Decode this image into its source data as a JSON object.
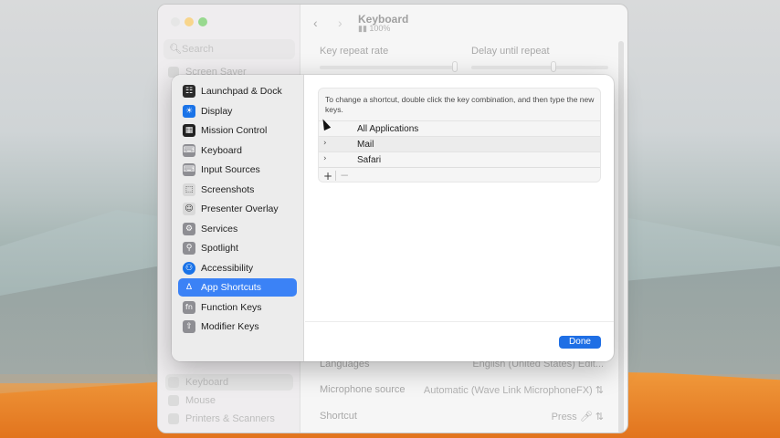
{
  "background_window": {
    "title": "Keyboard",
    "subtitle": "100%",
    "search_placeholder": "Search",
    "sidebar_items": [
      "Screen Saver",
      "Keyboard",
      "Mouse",
      "Printers & Scanners"
    ],
    "labels": {
      "key_repeat": "Key repeat rate",
      "delay_repeat": "Delay until repeat"
    },
    "rows": [
      {
        "label": "Languages",
        "value": "English (United States)",
        "action": "Edit..."
      },
      {
        "label": "Microphone source",
        "value": "Automatic (Wave Link MicrophoneFX)"
      },
      {
        "label": "Shortcut",
        "value": "Press"
      }
    ]
  },
  "modal": {
    "sidebar": [
      {
        "label": "Launchpad & Dock",
        "icon": "launchpad-icon",
        "color": "#2b2b2b"
      },
      {
        "label": "Display",
        "icon": "display-icon",
        "color": "#1a73e8"
      },
      {
        "label": "Mission Control",
        "icon": "mission-control-icon",
        "color": "#222222"
      },
      {
        "label": "Keyboard",
        "icon": "keyboard-icon",
        "color": "#8e8e93"
      },
      {
        "label": "Input Sources",
        "icon": "input-sources-icon",
        "color": "#8e8e93"
      },
      {
        "label": "Screenshots",
        "icon": "screenshots-icon",
        "color": "#d9d9d9"
      },
      {
        "label": "Presenter Overlay",
        "icon": "presenter-overlay-icon",
        "color": "#d9d9d9"
      },
      {
        "label": "Services",
        "icon": "services-gear-icon",
        "color": "#8e8e93"
      },
      {
        "label": "Spotlight",
        "icon": "spotlight-search-icon",
        "color": "#8e8e93"
      },
      {
        "label": "Accessibility",
        "icon": "accessibility-icon",
        "color": "#1a73e8"
      },
      {
        "label": "App Shortcuts",
        "icon": "app-shortcuts-icon",
        "color": "#3b82f6",
        "selected": true
      },
      {
        "label": "Function Keys",
        "icon": "function-keys-icon",
        "color": "#8e8e93"
      },
      {
        "label": "Modifier Keys",
        "icon": "modifier-keys-icon",
        "color": "#8e8e93"
      }
    ],
    "hint": "To change a shortcut, double click the key combination, and then type the new keys.",
    "apps": [
      {
        "name": "All Applications"
      },
      {
        "name": "Mail"
      },
      {
        "name": "Safari"
      }
    ],
    "add_label": "+",
    "remove_label": "−",
    "done_label": "Done"
  }
}
